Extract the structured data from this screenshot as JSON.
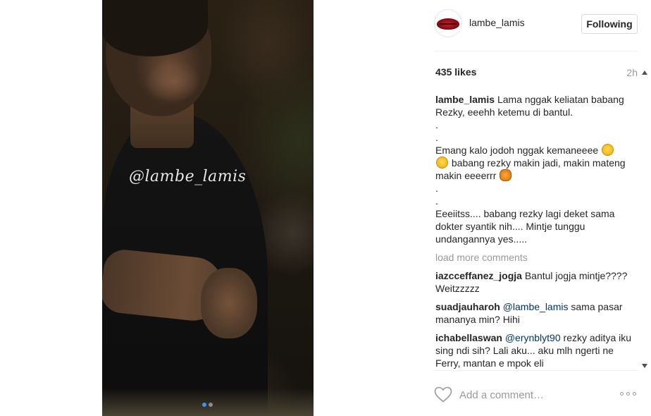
{
  "post": {
    "watermark": "@lambe_lamis",
    "carousel": {
      "count": 2,
      "active": 1
    }
  },
  "header": {
    "username": "lambe_lamis",
    "follow_label": "Following",
    "avatar_icon": "lips-avatar"
  },
  "stats": {
    "likes": "435 likes",
    "time": "2h"
  },
  "caption": {
    "user": "lambe_lamis",
    "line1": "Lama nggak keliatan babang Rezky, eeehh ketemu di bantul.",
    "dot1": ".",
    "dot2": ".",
    "line2a": "Emang kalo jodoh nggak kemaneeee",
    "line2b": "babang rezky makin jadi, makin mateng makin eeeerrr",
    "dot3": ".",
    "dot4": ".",
    "line3": "Eeeiitss.... babang rezky lagi deket sama dokter syantik nih.... Mintje tunggu undangannya yes....."
  },
  "load_more": "load more comments",
  "comments": [
    {
      "user": "iazcceffanez_jogja",
      "mention": "",
      "text": "Bantul jogja mintje???? Weitzzzzz"
    },
    {
      "user": "suadjauharoh",
      "mention": "@lambe_lamis",
      "text": "sama pasar mananya min? Hihi"
    },
    {
      "user": "ichabellaswan",
      "mention": "@erynblyt90",
      "text": "rezky aditya iku sing ndi sih? Lali aku... aku mlh ngerti ne Ferry, mantan e mpok eli"
    }
  ],
  "footer": {
    "comment_placeholder": "Add a comment…",
    "heart_icon": "heart-outline-icon",
    "more_icon": "more-options-icon"
  }
}
